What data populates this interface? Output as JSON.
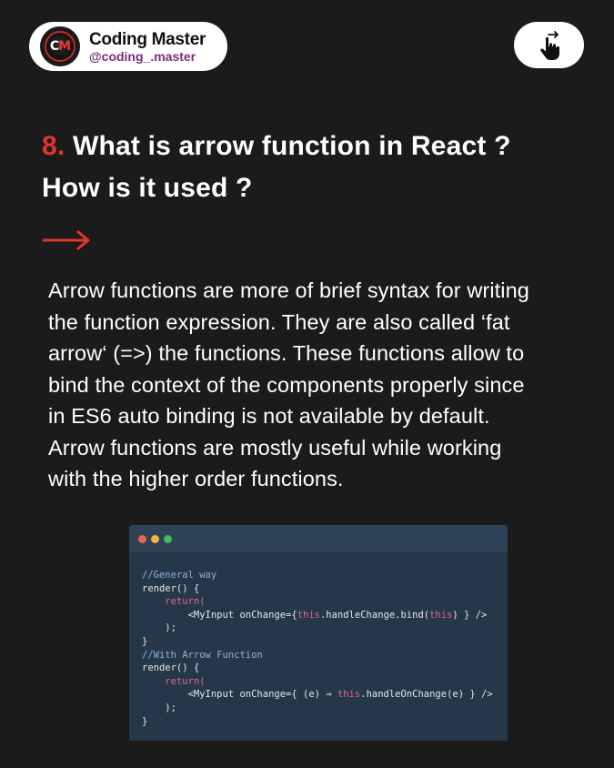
{
  "profile": {
    "avatar_initials_left": "C",
    "avatar_initials_right": "M",
    "name": "Coding Master",
    "handle": "@coding_.master"
  },
  "swipe": {
    "icon": "swipe-hand-icon"
  },
  "title": {
    "number": "8.",
    "line1": " What is arrow function in React ?",
    "line2": "How is it used ?"
  },
  "arrow_icon": "right-arrow-icon",
  "body": {
    "lines": [
      "Arrow functions are more of brief syntax for writing",
      "the function expression. They are also called ‘fat",
      "arrow‘ (=>) the functions. These functions allow to",
      "bind the context of the components properly since",
      "in ES6 auto binding is not available by default.",
      "Arrow functions are mostly useful while working",
      "with the higher order functions."
    ]
  },
  "code": {
    "dots": [
      "#ec5f56",
      "#f2b53d",
      "#3fbf53"
    ],
    "comment1": "//General way",
    "render1": "render() {",
    "return1": "return(",
    "jsx1_a": "<MyInput onChange={",
    "jsx1_this1": "this",
    "jsx1_b": ".handleChange.bind(",
    "jsx1_this2": "this",
    "jsx1_c": ") } />",
    "close_paren1": ");",
    "close_brace1": "}",
    "comment2": "//With Arrow Function",
    "render2": "render() {",
    "return2": "return(",
    "jsx2_a": "<MyInput onChange={ (e) ",
    "jsx2_arrow": "⇒",
    "jsx2_this": "this",
    "jsx2_b": ".handleOnChange(e) } />",
    "close_paren2": ");",
    "close_brace2": "}"
  },
  "colors": {
    "accent_red": "#e5342b",
    "background": "#1b1b1b",
    "code_bg": "#25384a",
    "handle_purple": "#7b2d7d"
  }
}
